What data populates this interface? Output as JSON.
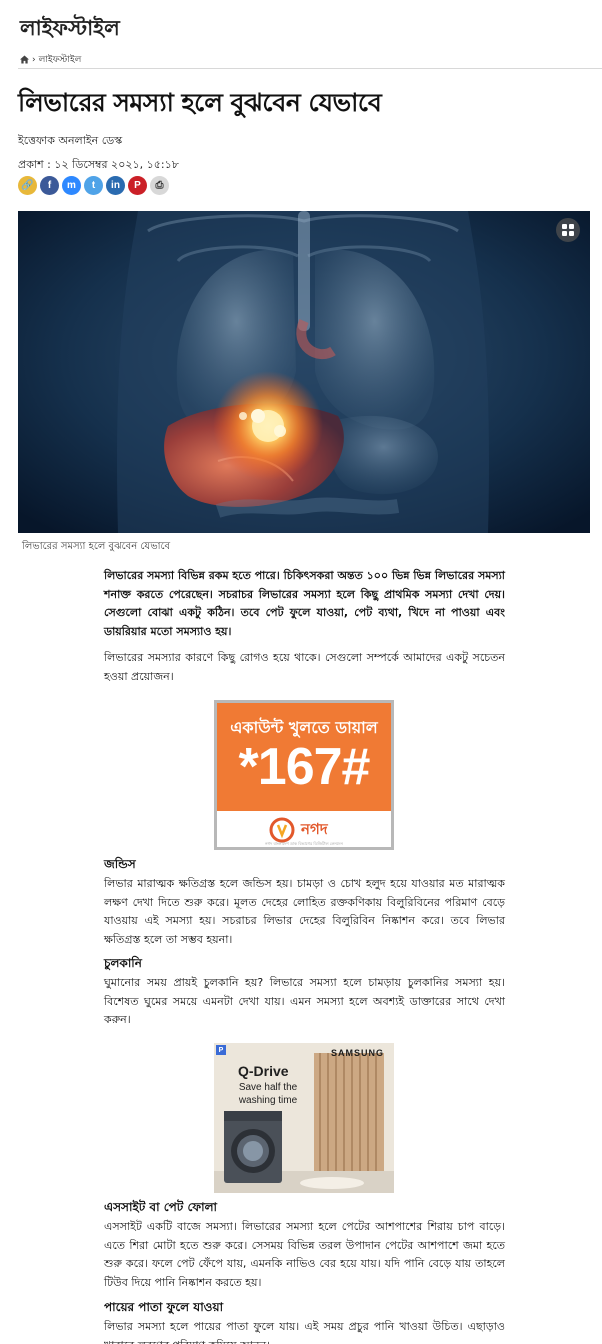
{
  "section": {
    "title": "লাইফস্টাইল"
  },
  "breadcrumb": {
    "current": "লাইফস্টাইল"
  },
  "article": {
    "headline": "লিভারের সমস্যা হলে বুঝবেন যেভাবে",
    "author": "ইত্তেফাক অনলাইন ডেস্ক",
    "published": "প্রকাশ : ১২ ডিসেম্বর ২০২১, ১৫:১৮",
    "image_caption": "লিভারের সমস্যা হলে বুঝবেন যেভাবে",
    "lead": "লিভারের সমস্যা বিভিন্ন রকম হতে পারে। চিকিৎসকরা অন্তত ১০০ ভিন্ন ভিন্ন লিভারের সমস্যা শনাক্ত করতে পেরেছেন। সচরাচর লিভারের সমস্যা হলে কিছু প্রাথমিক সমস্যা দেখা দেয়। সেগুলো বোঝা একটু কঠিন। তবে পেট ফুলে যাওয়া, পেট ব্যথা, খিদে না পাওয়া এবং ডায়রিয়ার মতো সমস্যাও হয়।",
    "para1": "লিভারের সমস্যার কারণে কিছু রোগও হয়ে থাকে। সেগুলো সম্পর্কে আমাদের একটু সচেতন হওয়া প্রয়োজন।",
    "sections": [
      {
        "heading": "জন্ডিস",
        "body": "লিভার মারাত্মক ক্ষতিগ্রস্ত হলে জন্ডিস হয়। চামড়া ও চোখ হলুদ হয়ে যাওয়ার মত মারাত্মক লক্ষণ দেখা দিতে শুরু করে। মূলত দেহের লোহিত রক্তকণিকায় বিলুরিবিনের পরিমাণ বেড়ে যাওয়ায় এই সমস্যা হয়। সচরাচর লিভার দেহের বিলুরিবিন নিষ্কাশন করে। তবে লিভার ক্ষতিগ্রস্ত হলে তা সম্ভব হয়না।"
      },
      {
        "heading": "চুলকানি",
        "body": "ঘুমানোর সময় প্রায়ই চুলকানি হয়? লিভারে সমস্যা হলে চামড়ায় চুলকানির সমস্যা হয়। বিশেষত ঘুমের সময়ে এমনটা দেখা যায়। এমন সমস্যা হলে অবশ্যই ডাক্তারের সাথে দেখা করুন।"
      },
      {
        "heading": "এসসাইট বা পেট ফোলা",
        "body": "এসসাইট একটি বাজে সমস্যা। লিভারের সমস্যা হলে পেটের আশপাশের শিরায় চাপ বাড়ে। এতে শিরা মোটা হতে শুরু করে। সেসময় বিভিন্ন তরল উপাদান পেটের আশপাশে জমা হতে শুরু করে। ফলে পেট ফেঁপে যায়, এমনকি নাভিও বের হয়ে যায়। যদি পানি বেড়ে যায় তাহলে টিউব দিয়ে পানি নিষ্কাশন করতে হয়।"
      },
      {
        "heading": "পায়ের পাতা ফুলে যাওয়া",
        "body": "লিভার সমস্যা হলে পায়ের পাতা ফুলে যায়। এই সময় প্রচুর পানি খাওয়া উচিত। এছাড়াও খাবারে লবণের পরিমাণ কমিয়ে আনুন।"
      }
    ]
  },
  "share_icons": [
    {
      "name": "copy-link-icon",
      "glyph": "🔗",
      "color": "#e8b83a"
    },
    {
      "name": "facebook-icon",
      "glyph": "f",
      "color": "#3b5998"
    },
    {
      "name": "messenger-icon",
      "glyph": "m",
      "color": "#2d88ff"
    },
    {
      "name": "twitter-icon",
      "glyph": "t",
      "color": "#4fa3e8"
    },
    {
      "name": "linkedin-icon",
      "glyph": "in",
      "color": "#2a6bb0"
    },
    {
      "name": "pinterest-icon",
      "glyph": "P",
      "color": "#cb2027"
    },
    {
      "name": "print-icon",
      "glyph": "⎙",
      "color": "#d8d8d8"
    }
  ],
  "ads": {
    "nagad": {
      "line1": "একাউন্ট খুলতে ডায়াল",
      "code": "*167#",
      "brand": "নগদ",
      "tagline": "নগদ বাংলাদেশ ডাক বিভাগের ডিজিটাল লেনদেন"
    },
    "samsung": {
      "brand": "SAMSUNG",
      "product": "Q-Drive",
      "tagline": "Save half the washing time"
    }
  },
  "colors": {
    "nagad_orange": "#f07a34",
    "hero_bg": "#0b1e33"
  }
}
